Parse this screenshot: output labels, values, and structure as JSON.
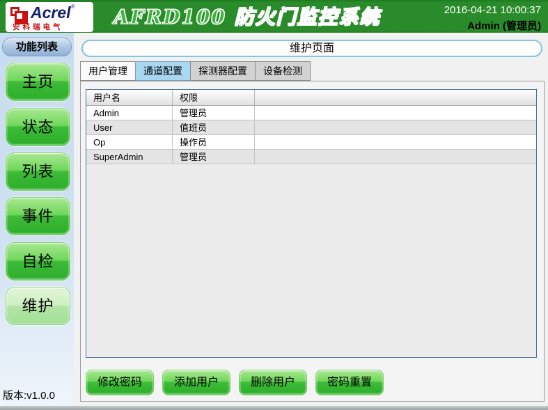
{
  "header": {
    "logo": {
      "brand": "Acrel",
      "registered": "®",
      "subtitle": "安科瑞电气"
    },
    "title": "AFRD100 防火门监控系统",
    "datetime": "2016-04-21 10:00:37",
    "user": "Admin (管理员)"
  },
  "sidebar": {
    "header_label": "功能列表",
    "items": [
      {
        "label": "主页",
        "active": false
      },
      {
        "label": "状态",
        "active": false
      },
      {
        "label": "列表",
        "active": false
      },
      {
        "label": "事件",
        "active": false
      },
      {
        "label": "自检",
        "active": false
      },
      {
        "label": "维护",
        "active": true
      }
    ],
    "version": "版本:v1.0.0"
  },
  "main": {
    "page_title": "维护页面",
    "tabs": [
      {
        "label": "用户管理",
        "state": "active"
      },
      {
        "label": "通道配置",
        "state": "highlight"
      },
      {
        "label": "探测器配置",
        "state": "normal"
      },
      {
        "label": "设备检测",
        "state": "normal"
      }
    ],
    "table": {
      "columns": [
        "用户名",
        "权限"
      ],
      "rows": [
        {
          "username": "Admin",
          "role": "管理员"
        },
        {
          "username": "User",
          "role": "值班员"
        },
        {
          "username": "Op",
          "role": "操作员"
        },
        {
          "username": "SuperAdmin",
          "role": "管理员"
        }
      ]
    },
    "buttons": {
      "change_password": "修改密码",
      "add_user": "添加用户",
      "delete_user": "删除用户",
      "reset_password": "密码重置"
    }
  },
  "colors": {
    "header_green": "#2a8b2a",
    "button_green": "#3dbb39",
    "sidebar_blue": "#c7dcf0",
    "tab_highlight": "#a8d7f2",
    "table_border": "#4a6f9b",
    "brand_navy": "#131f66",
    "brand_red": "#cc1111"
  }
}
